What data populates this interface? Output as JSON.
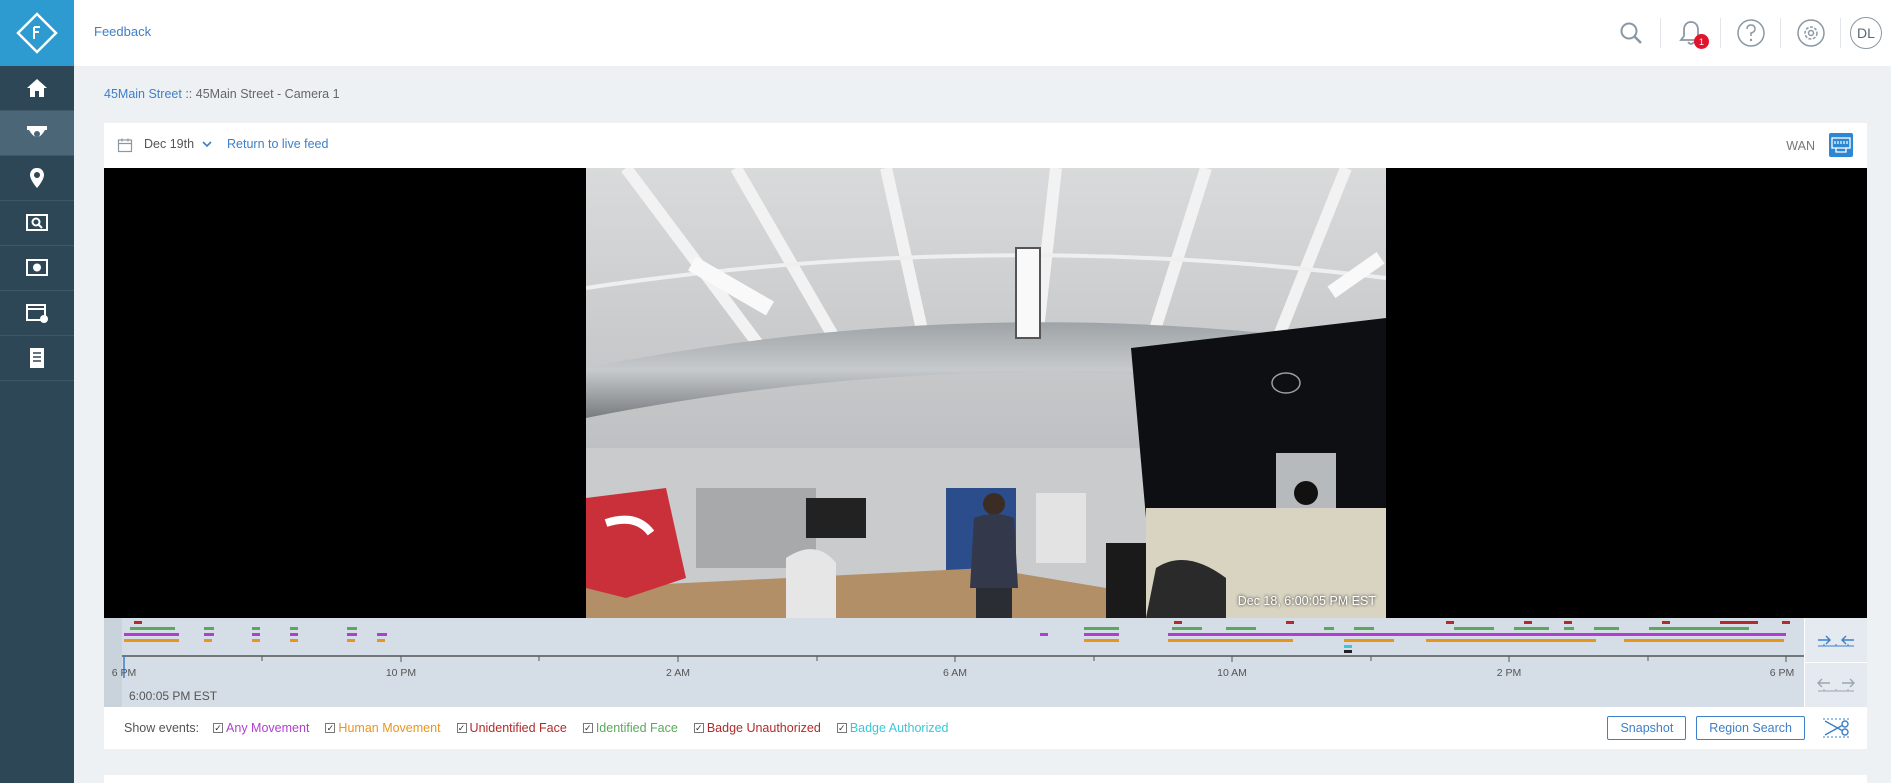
{
  "topbar": {
    "feedback_label": "Feedback",
    "notification_count": "1",
    "user_initials": "DL"
  },
  "breadcrumb": {
    "site": "45Main Street",
    "separator": "::",
    "camera": "45Main Street - Camera 1"
  },
  "player": {
    "date_selected": "Dec 19th",
    "return_label": "Return to live feed",
    "connection_label": "WAN",
    "video_timestamp": "Dec 18, 6:00:05 PM EST",
    "current_time": "6:00:05 PM EST",
    "progress_fraction": 0.0
  },
  "timeline": {
    "tick_labels": [
      "6 PM",
      "10 PM",
      "2 AM",
      "6 AM",
      "10 AM",
      "2 PM",
      "6 PM"
    ]
  },
  "events": {
    "label": "Show events:",
    "items": [
      {
        "label": "Any Movement",
        "color": "#b03fd0",
        "checked": true
      },
      {
        "label": "Human Movement",
        "color": "#e8951e",
        "checked": true
      },
      {
        "label": "Unidentified Face",
        "color": "#b32a2a",
        "checked": true
      },
      {
        "label": "Identified Face",
        "color": "#5aa85a",
        "checked": true
      },
      {
        "label": "Badge Unauthorized",
        "color": "#b32a2a",
        "checked": true
      },
      {
        "label": "Badge Authorized",
        "color": "#3cc6d8",
        "checked": true
      }
    ]
  },
  "actions": {
    "snapshot_label": "Snapshot",
    "region_search_label": "Region Search"
  },
  "colors": {
    "accent": "#3d7fc8",
    "sidebar": "#2d4757",
    "logo_bg": "#2d9bd0"
  }
}
